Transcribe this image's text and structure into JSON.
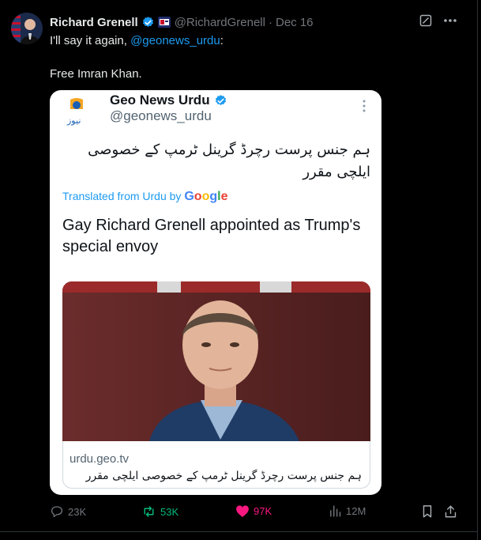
{
  "author": {
    "name": "Richard Grenell",
    "handle": "@RichardGrenell",
    "separator": "·",
    "date": "Dec 16"
  },
  "tweet": {
    "line1_prefix": "I'll say it again, ",
    "mention": "@geonews_urdu",
    "line1_suffix": ":",
    "line2": "Free Imran Khan."
  },
  "embedded": {
    "name": "Geo News Urdu",
    "handle": "@geonews_urdu",
    "urdu_text": "ہم جنس پرست رچرڈ گرینل ٹرمپ کے خصوصی ایلچی مقرر",
    "translated_prefix": "Translated from Urdu by ",
    "google_letters": [
      "G",
      "o",
      "o",
      "g",
      "l",
      "e"
    ],
    "translated_text": "Gay Richard Grenell appointed as Trump's special envoy",
    "link_domain": "urdu.geo.tv",
    "link_title": "ہم جنس پرست رچرڈ گرینل ٹرمپ کے خصوصی ایلچی مقرر",
    "logo_text": "نیوز"
  },
  "metrics": {
    "replies": "23K",
    "reposts": "53K",
    "likes": "97K",
    "views": "12M"
  },
  "colors": {
    "accent": "#1d9bf0",
    "repost": "#00ba7c",
    "like": "#f91880",
    "muted": "#71767b"
  },
  "icons": [
    "verified-badge-icon",
    "flag-icon",
    "grok-icon",
    "more-icon",
    "reply-icon",
    "repost-icon",
    "like-icon",
    "views-icon",
    "bookmark-icon",
    "share-icon"
  ]
}
